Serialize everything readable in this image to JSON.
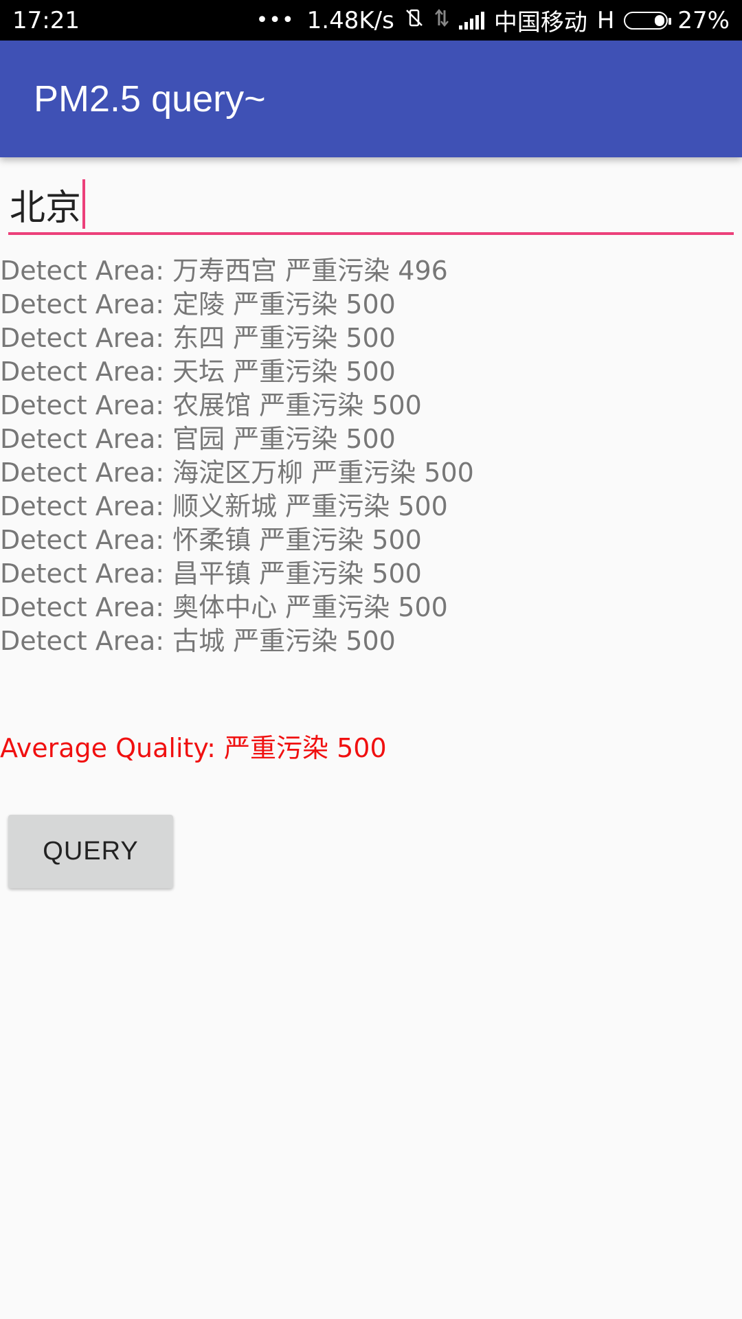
{
  "status_bar": {
    "time": "17:21",
    "dots": "•••",
    "speed": "1.48K/s",
    "carrier": "中国移动",
    "network_type": "H",
    "battery": "27%",
    "icons": [
      "vibrate-off-icon",
      "data-arrows-icon",
      "signal-icon",
      "battery-icon"
    ]
  },
  "app_bar": {
    "title": "PM2.5 query~",
    "color": "#3f51b5"
  },
  "search": {
    "value": "北京",
    "accent": "#ec407a"
  },
  "results": [
    "Detect Area: 万寿西宫 严重污染 496",
    "Detect Area: 定陵 严重污染 500",
    "Detect Area: 东四 严重污染 500",
    "Detect Area: 天坛 严重污染 500",
    "Detect Area: 农展馆 严重污染 500",
    "Detect Area: 官园 严重污染 500",
    "Detect Area: 海淀区万柳 严重污染 500",
    "Detect Area: 顺义新城 严重污染 500",
    "Detect Area: 怀柔镇 严重污染 500",
    "Detect Area: 昌平镇 严重污染 500",
    "Detect Area: 奥体中心 严重污染 500",
    "Detect Area: 古城 严重污染 500"
  ],
  "average": {
    "text": "Average Quality: 严重污染 500",
    "color": "#f01010"
  },
  "query_button": {
    "label": "QUERY"
  }
}
